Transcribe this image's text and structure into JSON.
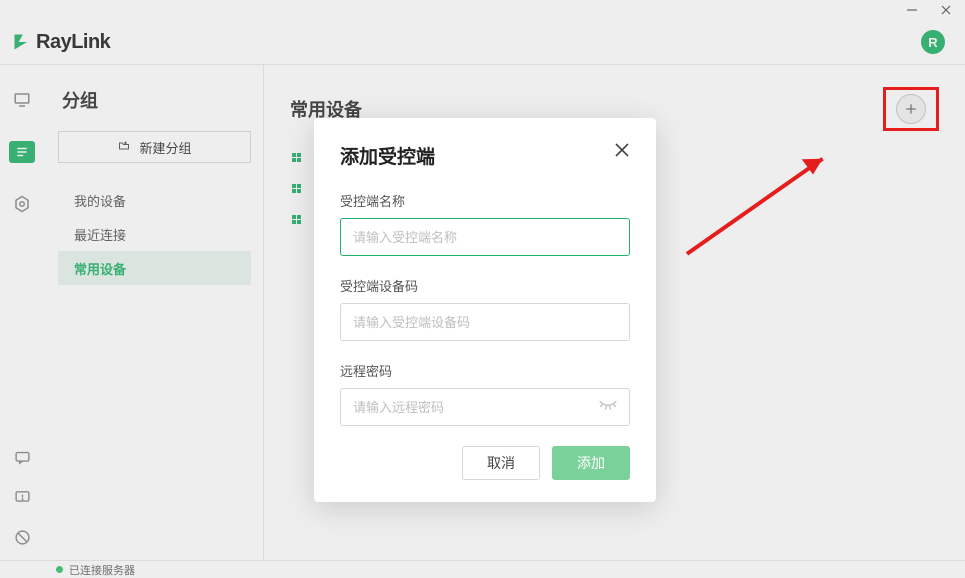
{
  "brand": {
    "name": "RayLink",
    "avatar_initial": "R"
  },
  "colors": {
    "accent": "#21b26a",
    "annotation": "#f40000"
  },
  "sidebar": {
    "title": "分组",
    "new_group_label": "新建分组",
    "items": [
      {
        "label": "我的设备",
        "active": false
      },
      {
        "label": "最近连接",
        "active": false
      },
      {
        "label": "常用设备",
        "active": true
      }
    ]
  },
  "main": {
    "title": "常用设备",
    "devices": [
      {
        "os": "windows"
      },
      {
        "os": "windows"
      },
      {
        "os": "windows"
      }
    ]
  },
  "modal": {
    "title": "添加受控端",
    "fields": {
      "name": {
        "label": "受控端名称",
        "placeholder": "请输入受控端名称",
        "value": ""
      },
      "code": {
        "label": "受控端设备码",
        "placeholder": "请输入受控端设备码",
        "value": ""
      },
      "password": {
        "label": "远程密码",
        "placeholder": "请输入远程密码",
        "value": ""
      }
    },
    "cancel_label": "取消",
    "confirm_label": "添加"
  },
  "status": {
    "text": "已连接服务器"
  }
}
